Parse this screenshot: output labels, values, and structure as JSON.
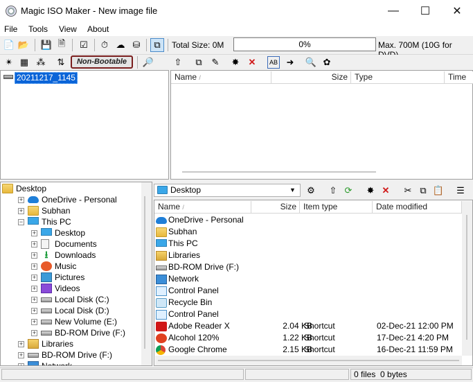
{
  "window": {
    "title": "Magic ISO Maker - New image file"
  },
  "menu": {
    "file": "File",
    "tools": "Tools",
    "view": "View",
    "about": "About"
  },
  "toolbar": {
    "total_size": "Total Size: 0M",
    "progress": "0%",
    "max_size": "Max. 700M (10G for DVD)",
    "boot_status": "Non-Bootable"
  },
  "image_tree": {
    "root": "20211217_1145"
  },
  "image_columns": {
    "name": "Name",
    "size": "Size",
    "type": "Type",
    "time": "Time"
  },
  "explorer_tree": [
    {
      "label": "Desktop",
      "icon": "folder-icon",
      "level": 0,
      "expander": ""
    },
    {
      "label": "OneDrive - Personal",
      "icon": "cloud-icon",
      "level": 1,
      "expander": "+"
    },
    {
      "label": "Subhan",
      "icon": "folder-icon",
      "level": 1,
      "expander": "+"
    },
    {
      "label": "This PC",
      "icon": "computer-icon",
      "level": 1,
      "expander": "−"
    },
    {
      "label": "Desktop",
      "icon": "desktop-icon",
      "level": 2,
      "expander": "+"
    },
    {
      "label": "Documents",
      "icon": "documents-icon",
      "level": 2,
      "expander": "+"
    },
    {
      "label": "Downloads",
      "icon": "download-icon",
      "level": 2,
      "expander": "+"
    },
    {
      "label": "Music",
      "icon": "music-icon",
      "level": 2,
      "expander": "+"
    },
    {
      "label": "Pictures",
      "icon": "pictures-icon",
      "level": 2,
      "expander": "+"
    },
    {
      "label": "Videos",
      "icon": "videos-icon",
      "level": 2,
      "expander": "+"
    },
    {
      "label": "Local Disk (C:)",
      "icon": "drive-icon",
      "level": 2,
      "expander": "+"
    },
    {
      "label": "Local Disk (D:)",
      "icon": "drive-icon",
      "level": 2,
      "expander": "+"
    },
    {
      "label": "New Volume (E:)",
      "icon": "drive-icon",
      "level": 2,
      "expander": "+"
    },
    {
      "label": "BD-ROM Drive (F:)",
      "icon": "disc-icon",
      "level": 2,
      "expander": "+"
    },
    {
      "label": "Libraries",
      "icon": "libraries-icon",
      "level": 1,
      "expander": "+"
    },
    {
      "label": "BD-ROM Drive (F:)",
      "icon": "disc-icon",
      "level": 1,
      "expander": "+"
    },
    {
      "label": "Network",
      "icon": "network-icon",
      "level": 1,
      "expander": "+"
    }
  ],
  "location": {
    "current": "Desktop"
  },
  "file_columns": {
    "name": "Name",
    "size": "Size",
    "type": "Item type",
    "modified": "Date modified"
  },
  "files": [
    {
      "name": "OneDrive - Personal",
      "icon": "cloud-icon",
      "size": "",
      "type": "",
      "modified": ""
    },
    {
      "name": "Subhan",
      "icon": "folder-icon",
      "size": "",
      "type": "",
      "modified": ""
    },
    {
      "name": "This PC",
      "icon": "computer-icon",
      "size": "",
      "type": "",
      "modified": ""
    },
    {
      "name": "Libraries",
      "icon": "libraries-icon",
      "size": "",
      "type": "",
      "modified": ""
    },
    {
      "name": "BD-ROM Drive (F:)",
      "icon": "disc-icon",
      "size": "",
      "type": "",
      "modified": ""
    },
    {
      "name": "Network",
      "icon": "network-icon",
      "size": "",
      "type": "",
      "modified": ""
    },
    {
      "name": "Control Panel",
      "icon": "control-panel-icon",
      "size": "",
      "type": "",
      "modified": ""
    },
    {
      "name": "Recycle Bin",
      "icon": "recycle-bin-icon",
      "size": "",
      "type": "",
      "modified": ""
    },
    {
      "name": "Control Panel",
      "icon": "control-panel-icon",
      "size": "",
      "type": "",
      "modified": ""
    },
    {
      "name": "Adobe Reader X",
      "icon": "pdf-icon",
      "size": "2.04 KB",
      "type": "Shortcut",
      "modified": "02-Dec-21 12:00 PM"
    },
    {
      "name": "Alcohol 120%",
      "icon": "alcohol-icon",
      "size": "1.22 KB",
      "type": "Shortcut",
      "modified": "17-Dec-21 4:20 PM"
    },
    {
      "name": "Google Chrome",
      "icon": "chrome-icon",
      "size": "2.15 KB",
      "type": "Shortcut",
      "modified": "16-Dec-21 11:59 PM"
    }
  ],
  "status": {
    "files": "0 files",
    "bytes": "0 bytes"
  }
}
